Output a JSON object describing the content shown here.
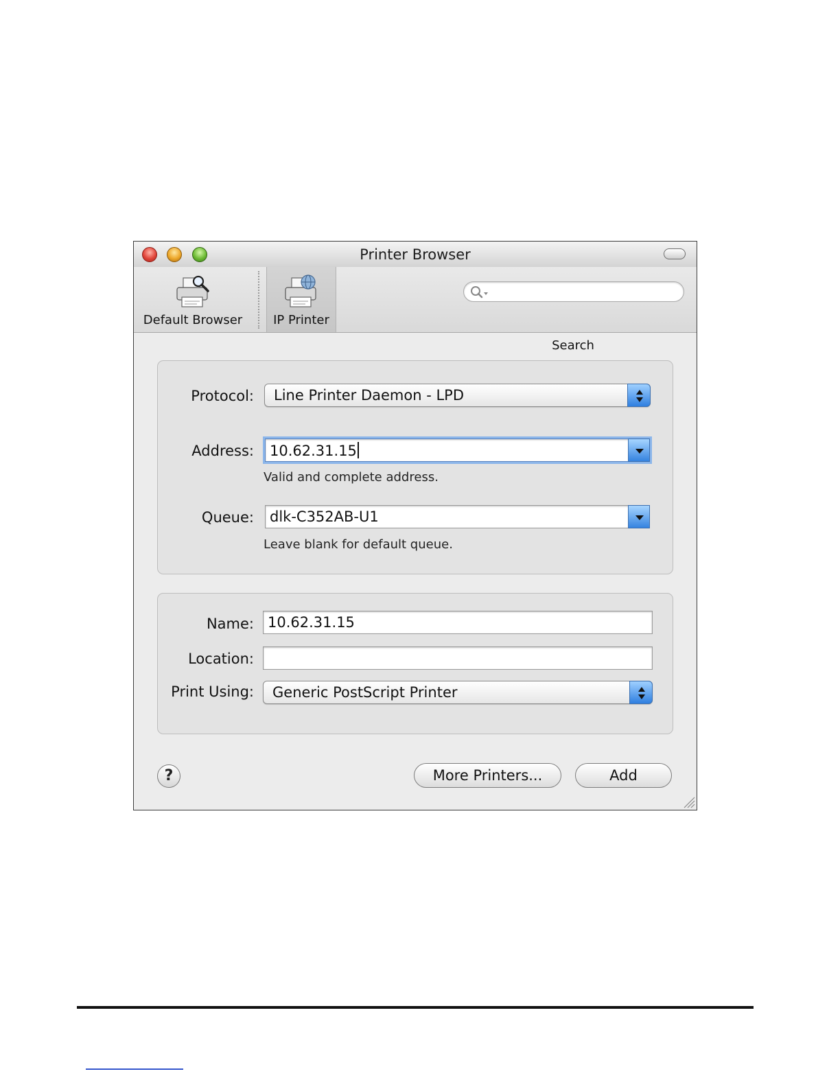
{
  "window": {
    "title": "Printer Browser"
  },
  "toolbar": {
    "default_browser_label": "Default Browser",
    "ip_printer_label": "IP Printer",
    "search_label": "Search",
    "search_value": ""
  },
  "form": {
    "protocol_label": "Protocol:",
    "protocol_value": "Line Printer Daemon - LPD",
    "address_label": "Address:",
    "address_value": "10.62.31.15",
    "address_hint": "Valid and complete address.",
    "queue_label": "Queue:",
    "queue_value": "dlk-C352AB-U1",
    "queue_hint": "Leave blank for default queue.",
    "name_label": "Name:",
    "name_value": "10.62.31.15",
    "location_label": "Location:",
    "location_value": "",
    "print_using_label": "Print Using:",
    "print_using_value": "Generic PostScript Printer"
  },
  "buttons": {
    "help": "?",
    "more_printers": "More Printers...",
    "add": "Add"
  },
  "icons": [
    "close-icon",
    "minimize-icon",
    "zoom-icon",
    "toolbar-toggle-icon",
    "default-browser-printer-icon",
    "ip-printer-icon",
    "search-icon",
    "popup-arrows-icon",
    "combo-arrow-icon",
    "resize-grip-icon"
  ]
}
